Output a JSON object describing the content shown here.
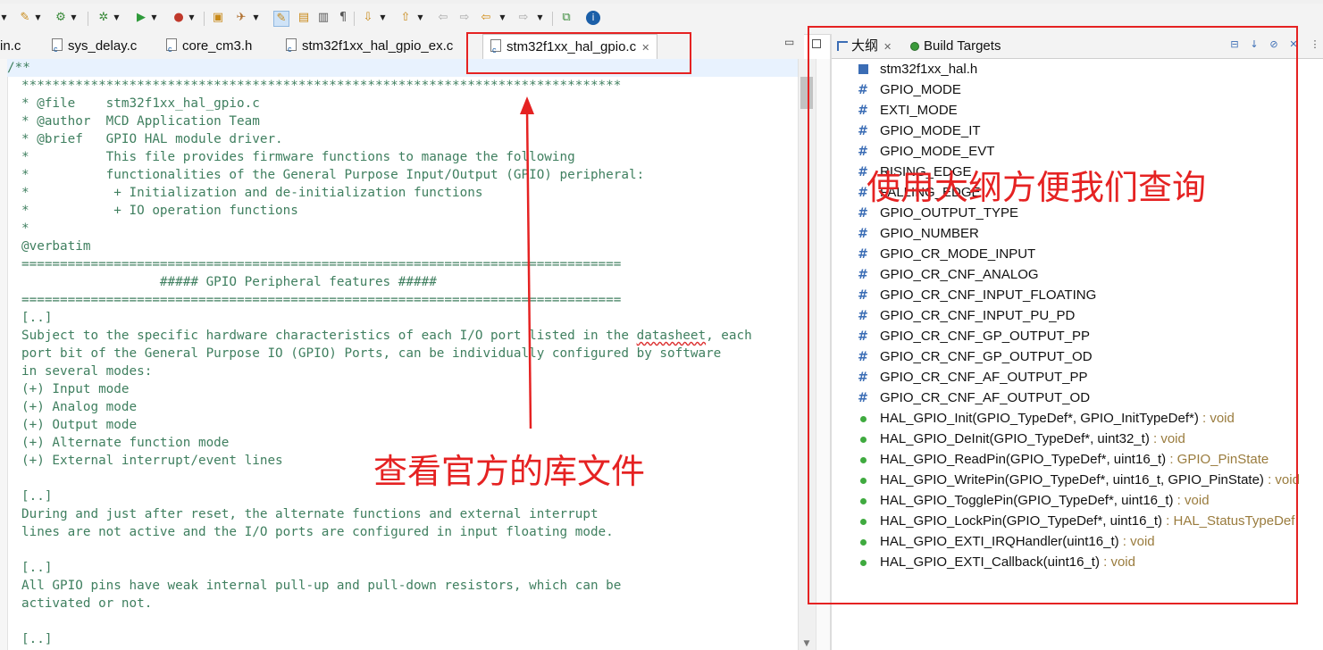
{
  "editor": {
    "tabs": [
      {
        "label": "in.c",
        "active": false
      },
      {
        "label": "sys_delay.c",
        "active": false
      },
      {
        "label": "core_cm3.h",
        "active": false
      },
      {
        "label": "stm32f1xx_hal_gpio_ex.c",
        "active": false
      },
      {
        "label": "stm32f1xx_hal_gpio.c",
        "active": true
      }
    ],
    "tab_close_glyph": "✕",
    "first_line": "/**",
    "lines": [
      "",
      "******************************************************************************",
      "* @file    stm32f1xx_hal_gpio.c",
      "* @author  MCD Application Team",
      "* @brief   GPIO HAL module driver.",
      "*          This file provides firmware functions to manage the following",
      "*          functionalities of the General Purpose Input/Output (GPIO) peripheral:",
      "*           + Initialization and de-initialization functions",
      "*           + IO operation functions",
      "*",
      "@verbatim",
      "==============================================================================",
      "                  ##### GPIO Peripheral features #####",
      "==============================================================================",
      "[..]",
      "Subject to the specific hardware characteristics of each I/O port listed in the datasheet, each",
      "port bit of the General Purpose IO (GPIO) Ports, can be individually configured by software",
      "in several modes:",
      "(+) Input mode",
      "(+) Analog mode",
      "(+) Output mode",
      "(+) Alternate function mode",
      "(+) External interrupt/event lines",
      "",
      "[..]",
      "During and just after reset, the alternate functions and external interrupt",
      "lines are not active and the I/O ports are configured in input floating mode.",
      "",
      "[..]",
      "All GPIO pins have weak internal pull-up and pull-down resistors, which can be",
      "activated or not.",
      "",
      "[..]"
    ]
  },
  "outline": {
    "tabs": [
      {
        "label": "大纲",
        "icon": "outline-icon"
      },
      {
        "label": "Build Targets",
        "icon": "build-targets-icon"
      }
    ],
    "items": [
      {
        "kind": "include",
        "name": "stm32f1xx_hal.h",
        "type": ""
      },
      {
        "kind": "macro",
        "name": "GPIO_MODE",
        "type": ""
      },
      {
        "kind": "macro",
        "name": "EXTI_MODE",
        "type": ""
      },
      {
        "kind": "macro",
        "name": "GPIO_MODE_IT",
        "type": ""
      },
      {
        "kind": "macro",
        "name": "GPIO_MODE_EVT",
        "type": ""
      },
      {
        "kind": "macro",
        "name": "RISING_EDGE",
        "type": ""
      },
      {
        "kind": "macro",
        "name": "FALLING_EDGE",
        "type": ""
      },
      {
        "kind": "macro",
        "name": "GPIO_OUTPUT_TYPE",
        "type": ""
      },
      {
        "kind": "macro",
        "name": "GPIO_NUMBER",
        "type": ""
      },
      {
        "kind": "macro",
        "name": "GPIO_CR_MODE_INPUT",
        "type": ""
      },
      {
        "kind": "macro",
        "name": "GPIO_CR_CNF_ANALOG",
        "type": ""
      },
      {
        "kind": "macro",
        "name": "GPIO_CR_CNF_INPUT_FLOATING",
        "type": ""
      },
      {
        "kind": "macro",
        "name": "GPIO_CR_CNF_INPUT_PU_PD",
        "type": ""
      },
      {
        "kind": "macro",
        "name": "GPIO_CR_CNF_GP_OUTPUT_PP",
        "type": ""
      },
      {
        "kind": "macro",
        "name": "GPIO_CR_CNF_GP_OUTPUT_OD",
        "type": ""
      },
      {
        "kind": "macro",
        "name": "GPIO_CR_CNF_AF_OUTPUT_PP",
        "type": ""
      },
      {
        "kind": "macro",
        "name": "GPIO_CR_CNF_AF_OUTPUT_OD",
        "type": ""
      },
      {
        "kind": "function",
        "name": "HAL_GPIO_Init(GPIO_TypeDef*, GPIO_InitTypeDef*)",
        "type": " : void"
      },
      {
        "kind": "function",
        "name": "HAL_GPIO_DeInit(GPIO_TypeDef*, uint32_t)",
        "type": " : void"
      },
      {
        "kind": "function",
        "name": "HAL_GPIO_ReadPin(GPIO_TypeDef*, uint16_t)",
        "type": " : GPIO_PinState"
      },
      {
        "kind": "function",
        "name": "HAL_GPIO_WritePin(GPIO_TypeDef*, uint16_t, GPIO_PinState)",
        "type": " : void"
      },
      {
        "kind": "function",
        "name": "HAL_GPIO_TogglePin(GPIO_TypeDef*, uint16_t)",
        "type": " : void"
      },
      {
        "kind": "function",
        "name": "HAL_GPIO_LockPin(GPIO_TypeDef*, uint16_t)",
        "type": " : HAL_StatusTypeDef"
      },
      {
        "kind": "function",
        "name": "HAL_GPIO_EXTI_IRQHandler(uint16_t)",
        "type": " : void"
      },
      {
        "kind": "function",
        "name": "HAL_GPIO_EXTI_Callback(uint16_t)",
        "type": " : void"
      }
    ]
  },
  "annotations": {
    "library_note": "查看官方的库文件",
    "outline_note": "使用大纲方便我们查询"
  },
  "colors": {
    "comment_green": "#3f7f5f",
    "annotation_red": "#e52222",
    "icon_blue": "#3b6db5",
    "function_green": "#3faa3f",
    "return_type": "#9a7c3e"
  }
}
